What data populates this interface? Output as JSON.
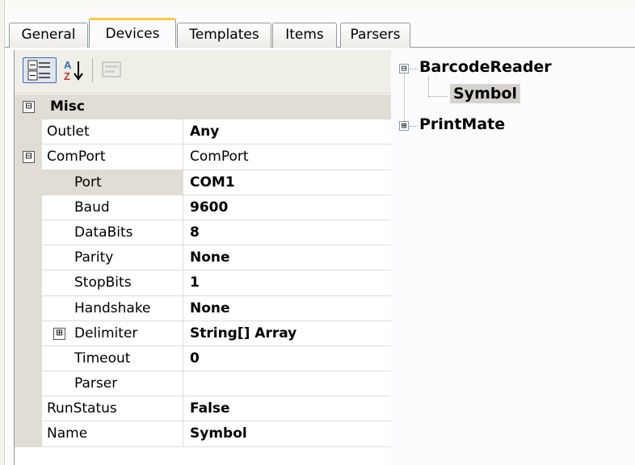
{
  "tabs": [
    {
      "label": "General"
    },
    {
      "label": "Devices"
    },
    {
      "label": "Templates"
    },
    {
      "label": "Items"
    },
    {
      "label": "Parsers"
    }
  ],
  "active_tab": "Devices",
  "toolbar": {
    "categorized_icon": "categorized-view-icon",
    "alphabetical_icon": "sort-az-icon",
    "property_pages_icon": "property-pages-icon"
  },
  "property_grid": {
    "category": {
      "label": "Misc",
      "expander": "⊟"
    },
    "rows": [
      {
        "name": "Outlet",
        "value": "Any"
      },
      {
        "name": "ComPort",
        "value": "ComPort",
        "expander": "⊟"
      },
      {
        "name": "Port",
        "value": "COM1"
      },
      {
        "name": "Baud",
        "value": "9600"
      },
      {
        "name": "DataBits",
        "value": "8"
      },
      {
        "name": "Parity",
        "value": "None"
      },
      {
        "name": "StopBits",
        "value": "1"
      },
      {
        "name": "Handshake",
        "value": "None"
      },
      {
        "name": "Delimiter",
        "value": "String[] Array",
        "expander": "⊞"
      },
      {
        "name": "Timeout",
        "value": "0"
      },
      {
        "name": "Parser",
        "value": ""
      },
      {
        "name": "RunStatus",
        "value": "False"
      },
      {
        "name": "Name",
        "value": "Symbol"
      }
    ]
  },
  "tree": {
    "nodes": [
      {
        "label": "BarcodeReader",
        "expander": "⊟"
      },
      {
        "label": "Symbol"
      },
      {
        "label": "PrintMate",
        "expander": "⊞"
      }
    ]
  },
  "colors": {
    "active_tab_accent": "#ffc83c",
    "grid_lines": "#e1ddd4",
    "selection": "#d6d3ce"
  }
}
